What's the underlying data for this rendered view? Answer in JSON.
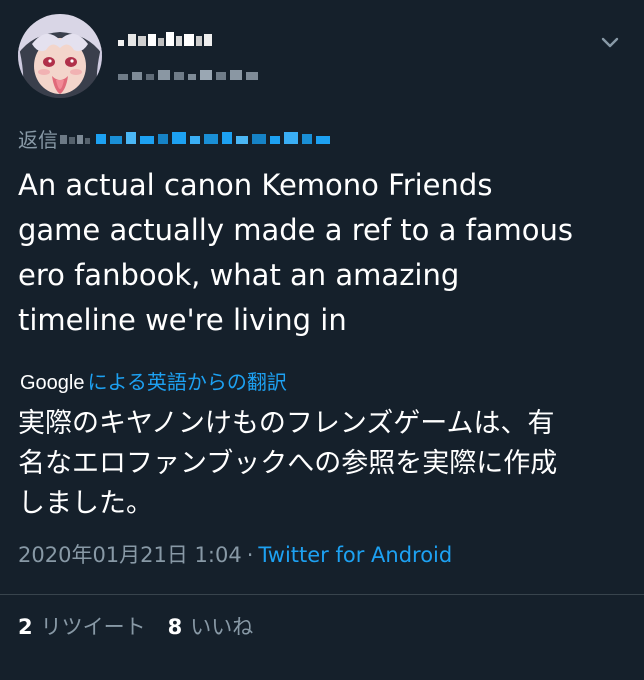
{
  "tweet": {
    "reply_prefix": "返信",
    "text": "An actual canon Kemono Friends\ngame actually made a ref to a famous\nero fanbook, what an amazing\ntimeline we're living in",
    "translate": {
      "provider": "Google",
      "label": "による英語からの翻訳"
    },
    "translated_text": "実際のキヤノンけものフレンズゲームは、有\n名なエロファンブックへの参照を実際に作成\nしました。",
    "timestamp": "2020年01月21日 1:04",
    "separator": "·",
    "source": "Twitter for Android",
    "stats": {
      "retweets_count": "2",
      "retweets_label": "リツイート",
      "likes_count": "8",
      "likes_label": "いいね"
    }
  },
  "colors": {
    "background": "#15202b",
    "text_primary": "#ffffff",
    "text_secondary": "#8899a6",
    "accent": "#1da1f2",
    "divider": "#38444d"
  },
  "icons": {
    "menu": "chevron-down-icon",
    "avatar": "avatar"
  }
}
